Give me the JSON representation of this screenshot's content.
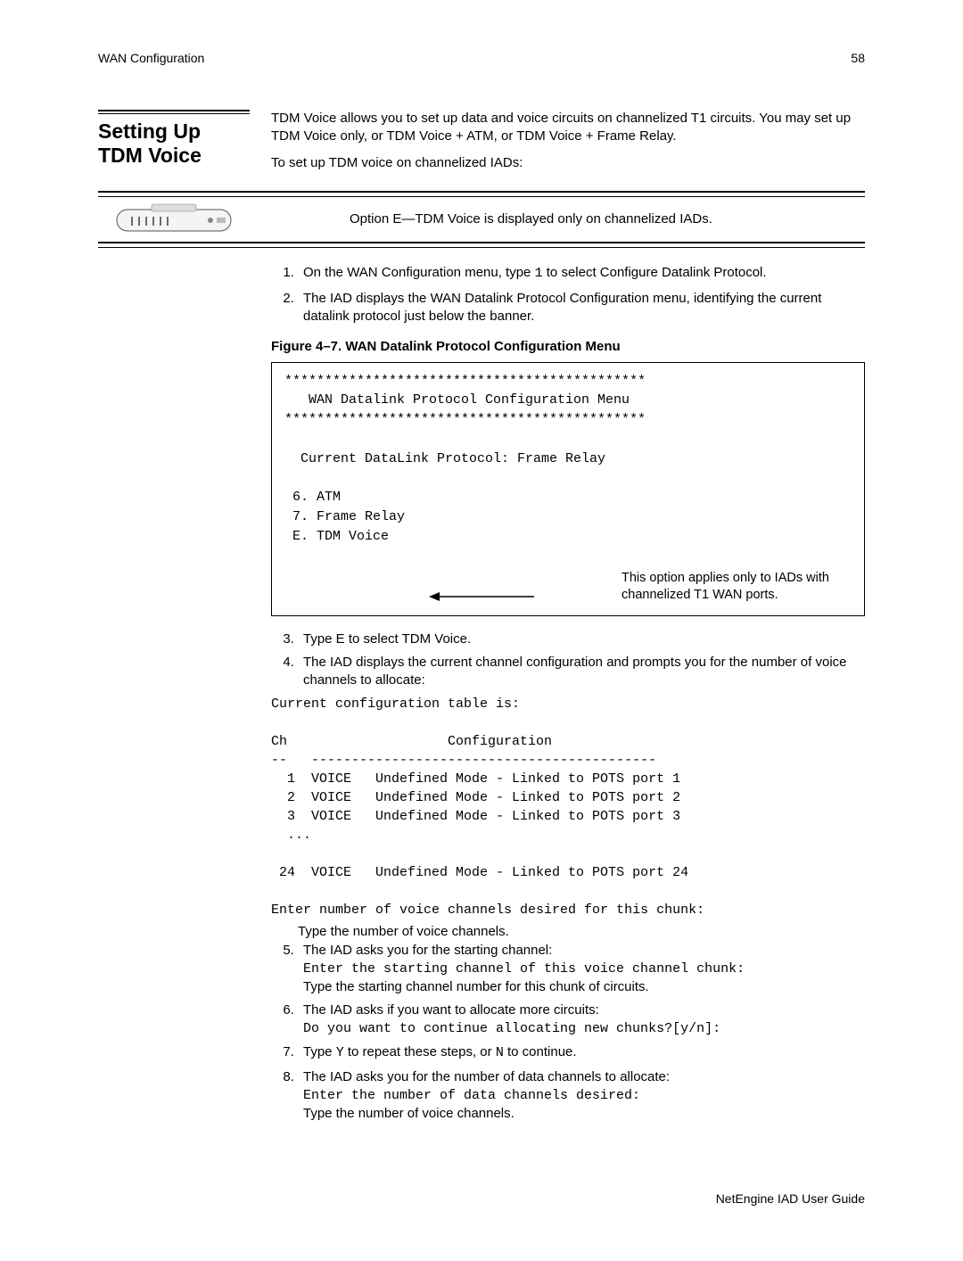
{
  "header": {
    "left": "WAN Configuration",
    "right": "58"
  },
  "section": {
    "title": "Setting Up TDM Voice"
  },
  "intro": {
    "p1": "TDM Voice allows you to set up data and voice circuits on channelized T1 circuits. You may set up TDM Voice only, or TDM Voice + ATM, or TDM Voice + Frame Relay.",
    "p2": "To set up TDM voice on channelized IADs:"
  },
  "note": "Option E—TDM Voice is displayed only on channelized IADs.",
  "step1": {
    "pre": "On the WAN Configuration menu, type ",
    "key": "1",
    "post": " to select Configure Datalink Protocol."
  },
  "step2": "The IAD displays the WAN Datalink Protocol Configuration menu, identifying the current datalink protocol just below the banner.",
  "figcap": "Figure 4–7.  WAN Datalink Protocol Configuration Menu",
  "menubox": {
    "l1": "*********************************************",
    "l2": "   WAN Datalink Protocol Configuration Menu",
    "l3": "*********************************************",
    "l4": "  Current DataLink Protocol: Frame Relay",
    "l5": " 6. ATM",
    "l6": " 7. Frame Relay",
    "l7": " E. TDM Voice",
    "annot": "This option applies only to IADs with channelized T1 WAN ports."
  },
  "step3": "Type E to select TDM Voice.",
  "step4": "The IAD displays the current channel configuration and prompts you for the number of voice channels to allocate:",
  "cfg": {
    "l1": "Current configuration table is:",
    "l2": "Ch                    Configuration",
    "l3": "--   -------------------------------------------",
    "l4": "  1  VOICE   Undefined Mode - Linked to POTS port 1",
    "l5": "  2  VOICE   Undefined Mode - Linked to POTS port 2",
    "l6": "  3  VOICE   Undefined Mode - Linked to POTS port 3",
    "l7": "  ...",
    "l8": " 24  VOICE   Undefined Mode - Linked to POTS port 24",
    "l9": "Enter number of voice channels desired for this chunk:"
  },
  "step4b": "Type the number of voice channels.",
  "step5": {
    "a": "The IAD asks you for the starting channel:",
    "b": "Enter the starting channel of this voice channel chunk:",
    "c": "Type the starting channel number for this chunk of circuits."
  },
  "step6": {
    "a": "The IAD asks if you want to allocate more circuits:",
    "b": "Do you want to continue allocating new chunks?[y/n]:"
  },
  "step7": {
    "pre": "Type ",
    "y": "Y",
    "mid": " to repeat these steps, or ",
    "n": "N",
    "post": " to continue."
  },
  "step8": {
    "a": "The IAD asks you for the number of data channels to allocate:",
    "b": "Enter the number of data channels desired:",
    "c": "Type the number of voice channels."
  },
  "footer": "NetEngine IAD User Guide"
}
